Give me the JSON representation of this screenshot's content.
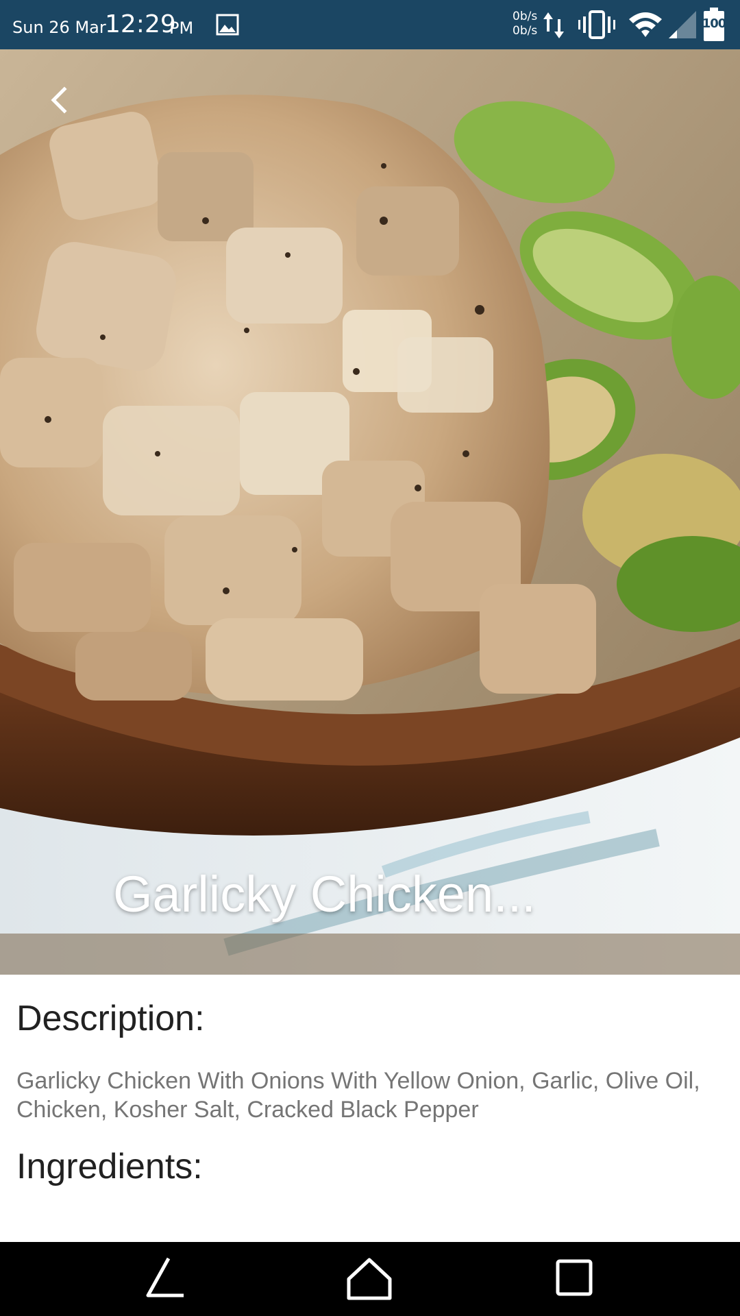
{
  "status_bar": {
    "date": "Sun 26 Mar",
    "time": "12:29",
    "ampm": "PM",
    "upload_speed": "0b/s",
    "download_speed": "0b/s",
    "battery": "100",
    "icons": [
      "gallery-icon",
      "data-transfer-icon",
      "vibrate-icon",
      "wifi-icon",
      "signal-icon",
      "battery-icon"
    ]
  },
  "recipe": {
    "title": "Garlicky Chicken...",
    "description_heading": "Description:",
    "description": "Garlicky Chicken With Onions With Yellow Onion, Garlic, Olive Oil, Chicken, Kosher Salt, Cracked Black Pepper",
    "ingredients_heading": "Ingredients:"
  },
  "navigation": {
    "icons": [
      "back-nav-icon",
      "home-nav-icon",
      "recents-nav-icon"
    ]
  },
  "colors": {
    "status_bar": "#1b4663",
    "heading_text": "#212121",
    "body_text": "#757575",
    "nav_bar": "#000000"
  }
}
